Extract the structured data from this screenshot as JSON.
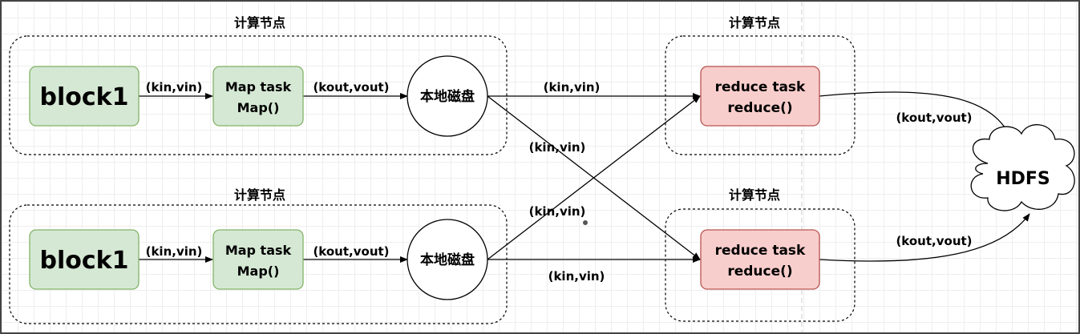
{
  "groups": {
    "map_top": "计算节点",
    "map_bottom": "计算节点",
    "reduce_top": "计算节点",
    "reduce_bottom": "计算节点"
  },
  "nodes": {
    "block_top": "block1",
    "block_bottom": "block1",
    "map_top": [
      "Map task",
      "Map()"
    ],
    "map_bottom": [
      "Map task",
      "Map()"
    ],
    "disk_top": "本地磁盘",
    "disk_bottom": "本地磁盘",
    "reduce_top": [
      "reduce task",
      "reduce()"
    ],
    "reduce_bottom": [
      "reduce task",
      "reduce()"
    ],
    "hdfs": "HDFS"
  },
  "edges": {
    "block_to_map_top": "(kin,vin)",
    "block_to_map_bottom": "(kin,vin)",
    "map_to_disk_top": "(kout,vout)",
    "map_to_disk_bottom": "(kout,vout)",
    "disk_top_to_reduce_top": "(kin,vin)",
    "disk_top_to_reduce_bottom": "(kin,vin)",
    "disk_bottom_to_reduce_top": "(kin,vin)",
    "disk_bottom_to_reduce_bottom": "(kin,vin)",
    "reduce_top_to_hdfs": "(kout,vout)",
    "reduce_bottom_to_hdfs": "(kout,vout)"
  },
  "colors": {
    "map_fill": "#d5e8d4",
    "map_stroke": "#82b366",
    "reduce_fill": "#f8cecc",
    "reduce_stroke": "#b85450"
  }
}
